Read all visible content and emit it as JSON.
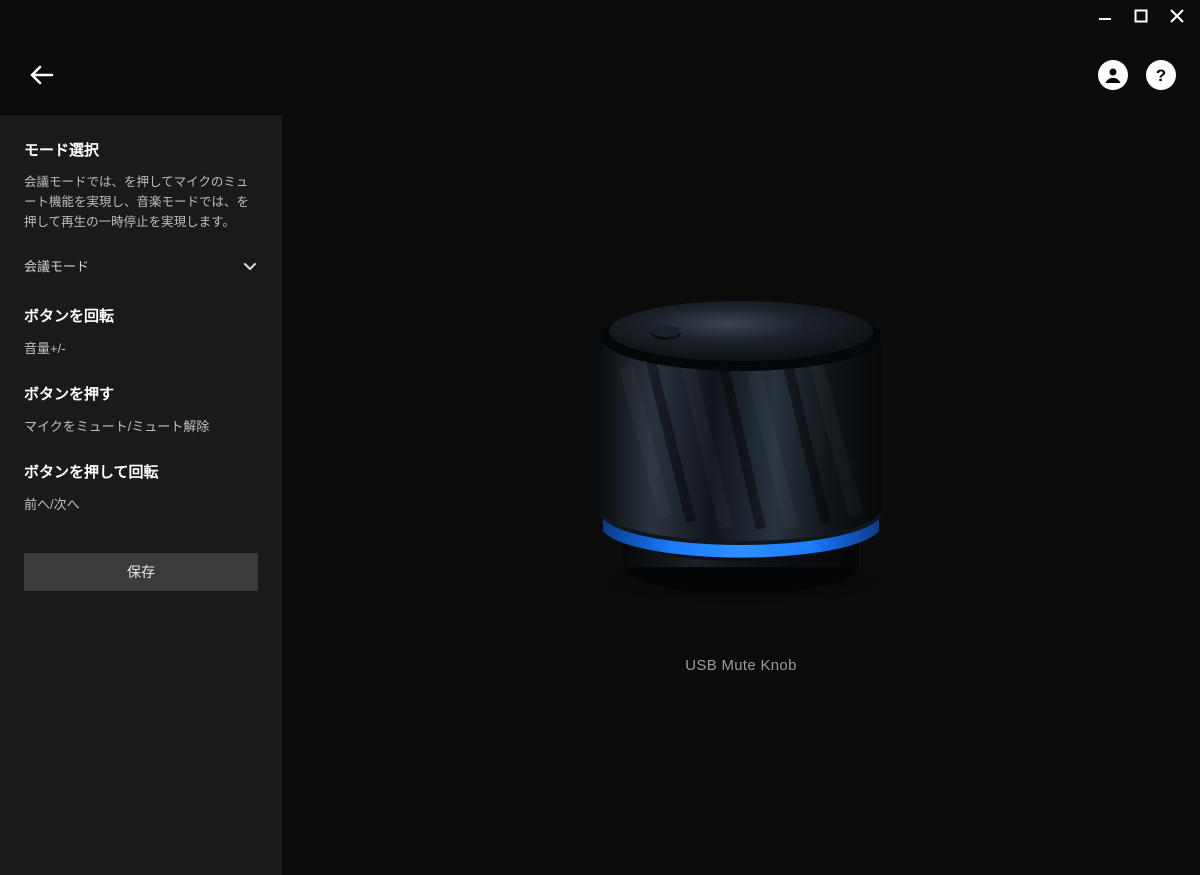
{
  "sidebar": {
    "mode_select": {
      "title": "モード選択",
      "description": "会議モードでは、を押してマイクのミュート機能を実現し、音楽モードでは、を押して再生の一時停止を実現します。",
      "selected": "会議モード"
    },
    "rotate": {
      "title": "ボタンを回転",
      "value": "音量+/-"
    },
    "press": {
      "title": "ボタンを押す",
      "value": "マイクをミュート/ミュート解除"
    },
    "press_rotate": {
      "title": "ボタンを押して回転",
      "value": "前へ/次へ"
    },
    "save_label": "保存"
  },
  "main": {
    "device_label": "USB Mute Knob"
  }
}
